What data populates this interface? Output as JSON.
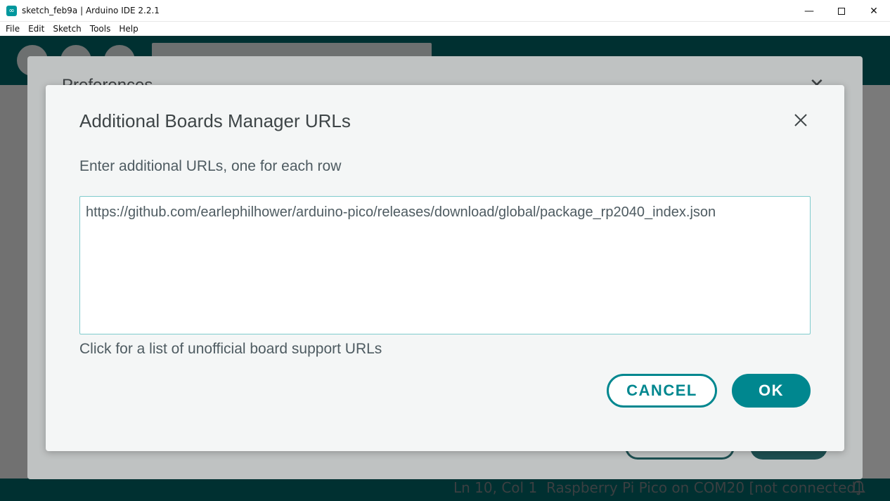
{
  "window": {
    "title": "sketch_feb9a | Arduino IDE 2.2.1",
    "app_icon": "∞",
    "minimize": "—",
    "close": "✕"
  },
  "menu": [
    "File",
    "Edit",
    "Sketch",
    "Tools",
    "Help"
  ],
  "status_bar": {
    "position": "Ln 10, Col 1",
    "board": "Raspberry Pi Pico on COM20 [not connected]"
  },
  "preferences_dialog": {
    "title": "Preferences"
  },
  "boards_dialog": {
    "title": "Additional Boards Manager URLs",
    "subtitle": "Enter additional URLs, one for each row",
    "urls_value": "https://github.com/earlephilhower/arduino-pico/releases/download/global/package_rp2040_index.json",
    "link_text": "Click for a list of unofficial board support URLs",
    "cancel_label": "CANCEL",
    "ok_label": "OK"
  },
  "colors": {
    "accent": "#00878f",
    "toolbar": "#006468"
  }
}
